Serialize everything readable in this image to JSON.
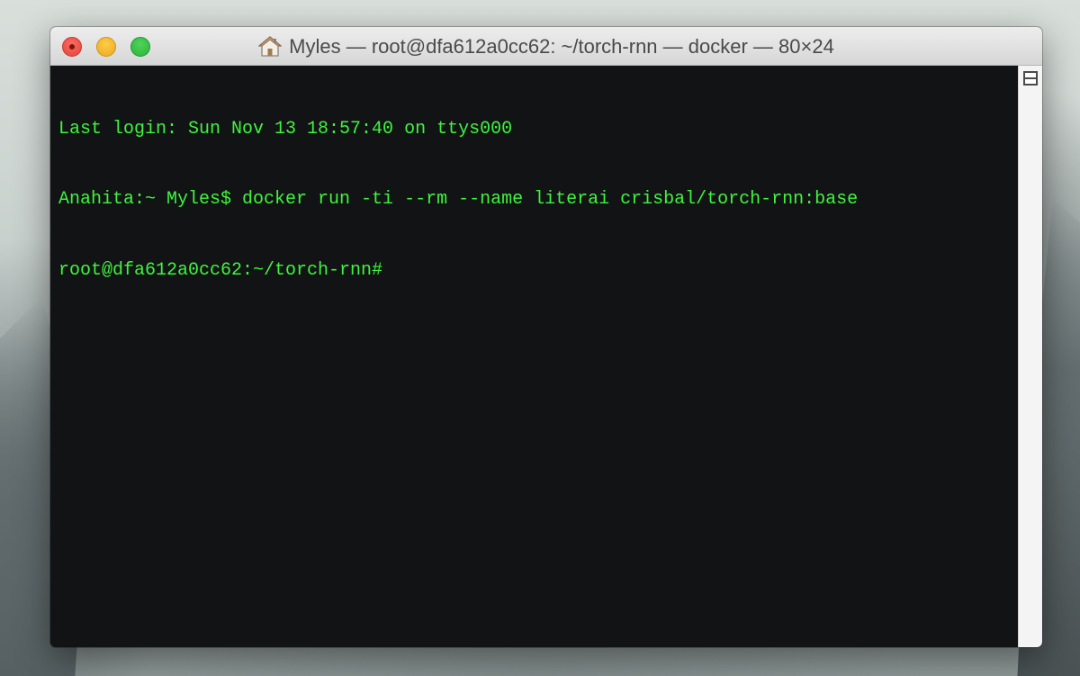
{
  "window": {
    "title": "Myles — root@dfa612a0cc62: ~/torch-rnn — docker — 80×24",
    "title_icon": "home-icon"
  },
  "terminal": {
    "lines": [
      "Last login: Sun Nov 13 18:57:40 on ttys000",
      "Anahita:~ Myles$ docker run -ti --rm --name literai crisbal/torch-rnn:base",
      "root@dfa612a0cc62:~/torch-rnn# "
    ],
    "text_color": "#3ef43e",
    "background": "#121314"
  },
  "colors": {
    "close": "#ff5f57",
    "minimize": "#ffbd2e",
    "zoom": "#28c940"
  }
}
